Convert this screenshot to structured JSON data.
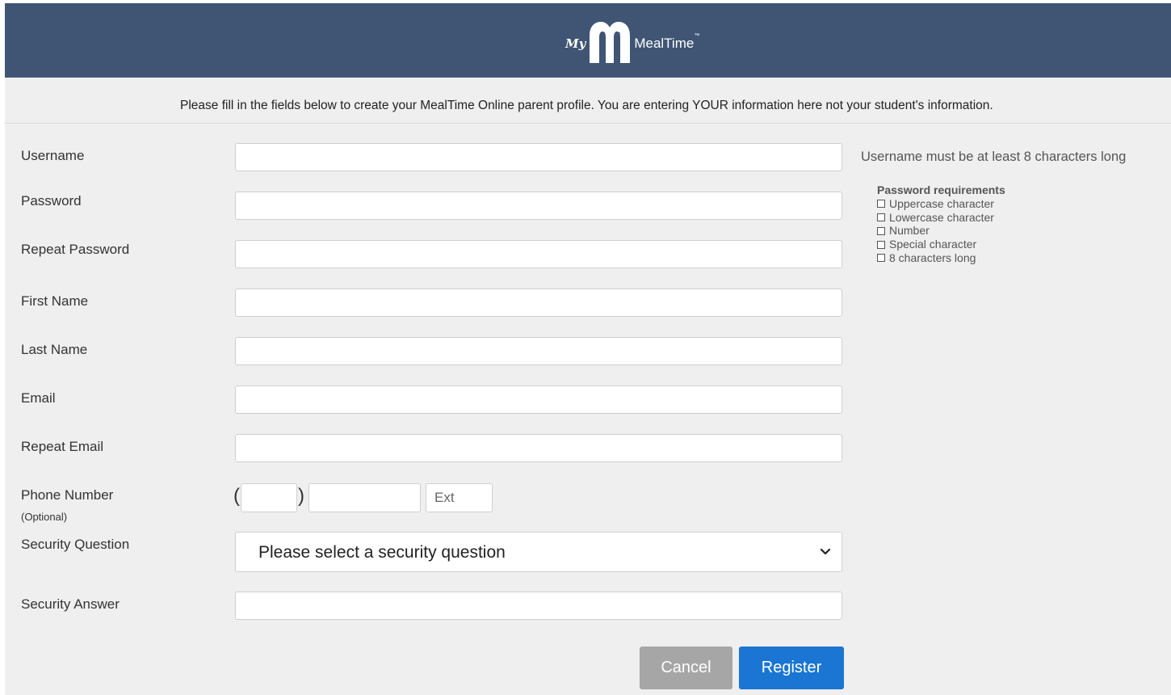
{
  "header": {
    "logo_prefix": "My",
    "logo_name": "MealTime",
    "logo_tm": "™",
    "background": "#3f5573"
  },
  "intro": "Please fill in the fields below to create your MealTime Online parent profile. You are entering YOUR information here not your student's information.",
  "form": {
    "username_label": "Username",
    "password_label": "Password",
    "repeat_password_label": "Repeat Password",
    "first_name_label": "First Name",
    "last_name_label": "Last Name",
    "email_label": "Email",
    "repeat_email_label": "Repeat Email",
    "phone_label": "Phone Number",
    "phone_optional": "(Optional)",
    "phone_open_paren": "(",
    "phone_close_paren": ")",
    "phone_ext_placeholder": "Ext",
    "security_question_label": "Security Question",
    "security_question_selected": "Please select a security question",
    "security_answer_label": "Security Answer",
    "username_value": "",
    "password_value": "",
    "repeat_password_value": "",
    "first_name_value": "",
    "last_name_value": "",
    "email_value": "",
    "repeat_email_value": "",
    "security_answer_value": ""
  },
  "hints": {
    "username_hint": "Username must be at least 8 characters long",
    "password_requirements_title": "Password requirements",
    "password_requirements": [
      "Uppercase character",
      "Lowercase character",
      "Number",
      "Special character",
      "8 characters long"
    ]
  },
  "buttons": {
    "cancel_label": "Cancel",
    "register_label": "Register",
    "cancel_color": "#a6a6a6",
    "register_color": "#1a76d2"
  },
  "icons": {
    "logo": "mealtime-logo-icon",
    "select_chevron": "chevron-down-icon",
    "requirement_checkbox": "checkbox-icon"
  }
}
